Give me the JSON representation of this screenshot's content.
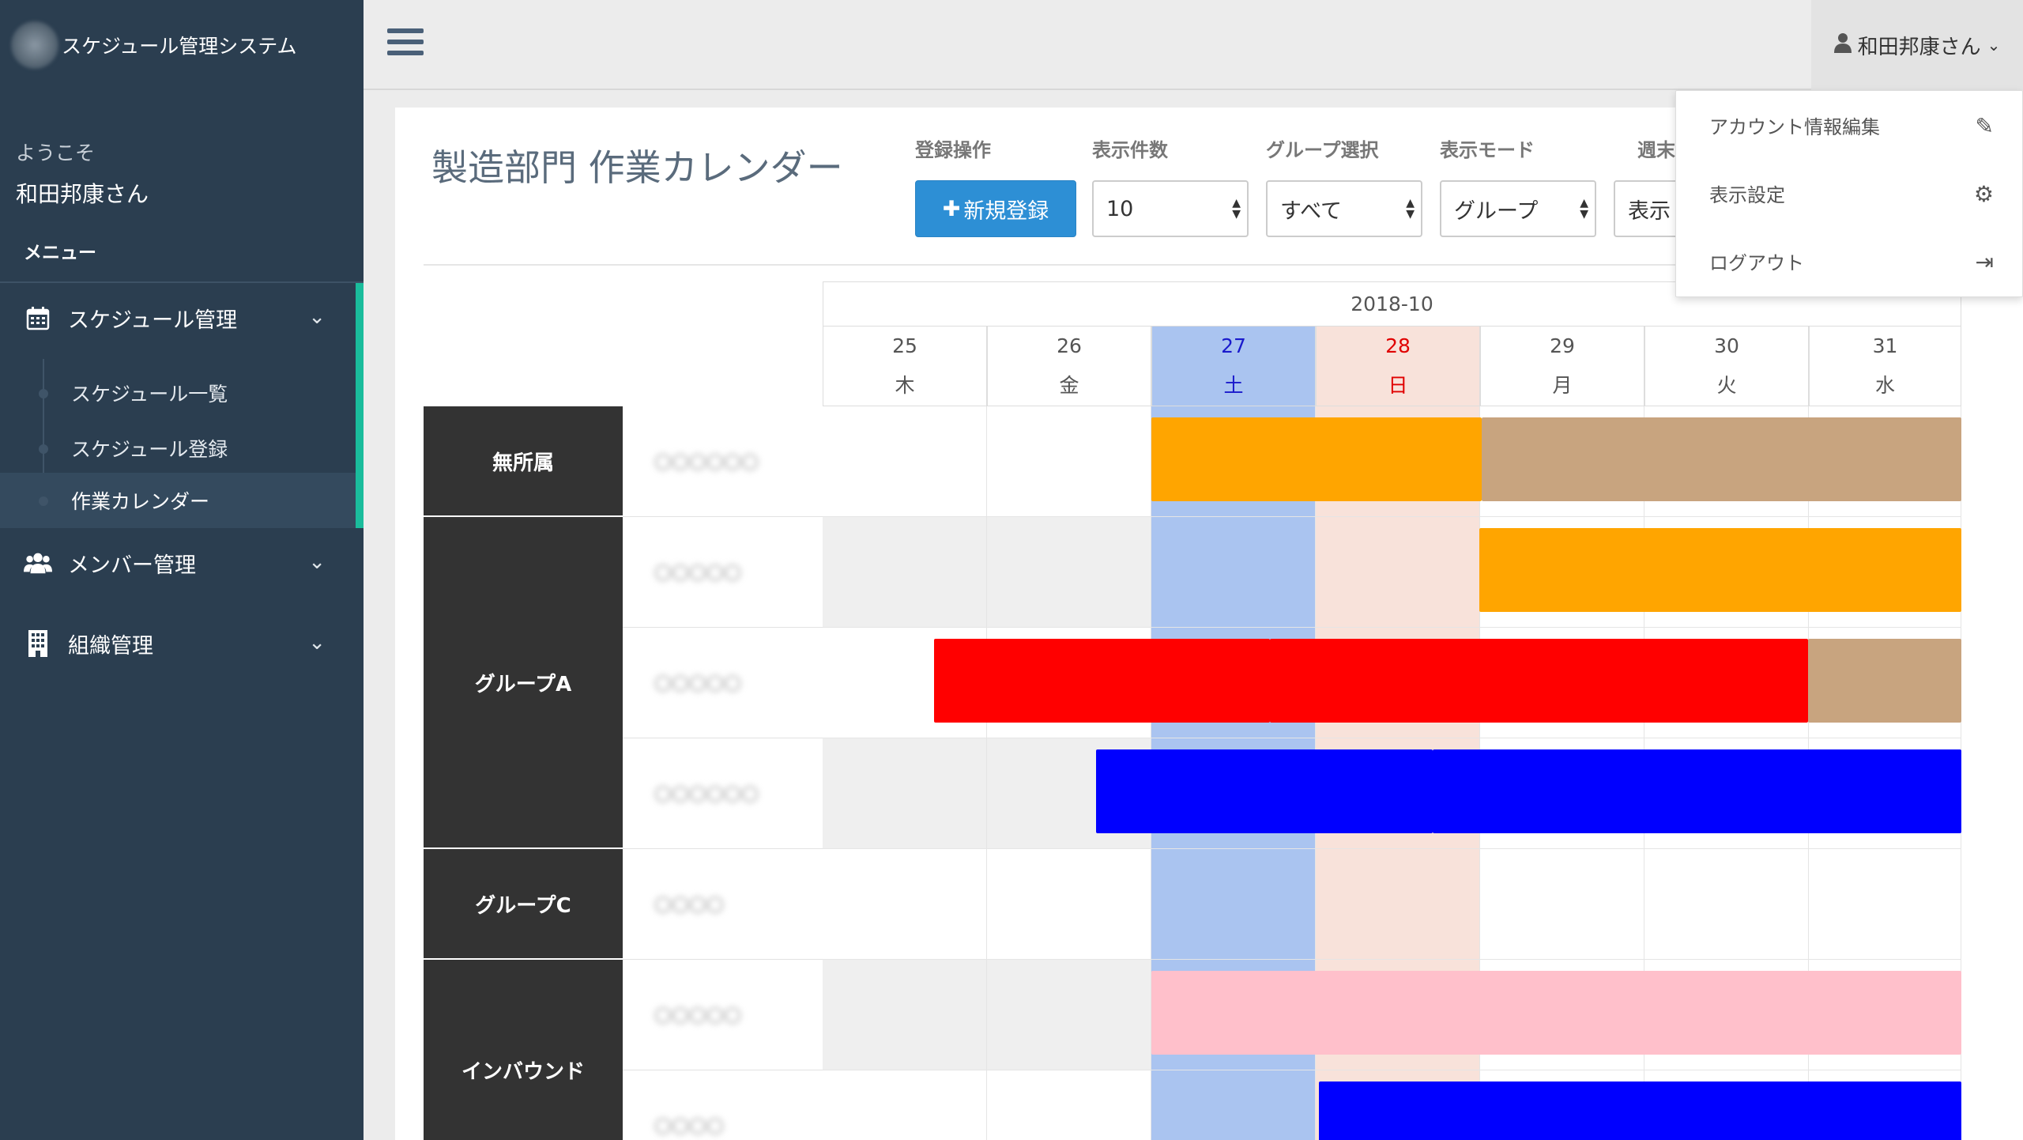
{
  "app": {
    "title": "スケジュール管理システム"
  },
  "sidebar": {
    "welcome_label": "ようこそ",
    "user_name": "和田邦康さん",
    "menu_heading": "メニュー",
    "items": [
      {
        "label": "スケジュール管理",
        "icon": "calendar-icon"
      },
      {
        "label": "メンバー管理",
        "icon": "users-icon"
      },
      {
        "label": "組織管理",
        "icon": "building-icon"
      }
    ],
    "sub_items": [
      {
        "label": "スケジュール一覧"
      },
      {
        "label": "スケジュール登録"
      },
      {
        "label": "作業カレンダー"
      }
    ]
  },
  "topbar": {
    "user_button_label": "和田邦康さん"
  },
  "user_menu": {
    "items": [
      {
        "label": "アカウント情報編集",
        "icon": "pencil-icon"
      },
      {
        "label": "表示設定",
        "icon": "gear-icon"
      },
      {
        "label": "ログアウト",
        "icon": "sign-out-icon"
      }
    ]
  },
  "page": {
    "title": "製造部門 作業カレンダー",
    "controls": {
      "register_label": "登録操作",
      "new_button": "新規登録",
      "count_label": "表示件数",
      "count_value": "10",
      "group_label": "グループ選択",
      "group_value": "すべて",
      "mode_label": "表示モード",
      "mode_value": "グループ",
      "week_label": "週末",
      "week_value": "表示"
    }
  },
  "calendar": {
    "month": "2018-10",
    "days": [
      {
        "date": "25",
        "weekday": "木"
      },
      {
        "date": "26",
        "weekday": "金"
      },
      {
        "date": "27",
        "weekday": "土"
      },
      {
        "date": "28",
        "weekday": "日"
      },
      {
        "date": "29",
        "weekday": "月"
      },
      {
        "date": "30",
        "weekday": "火"
      },
      {
        "date": "31",
        "weekday": "水"
      }
    ],
    "groups": [
      {
        "name": "無所属"
      },
      {
        "name": "グループA"
      },
      {
        "name": "グループC"
      },
      {
        "name": "インバウンド"
      }
    ],
    "members": [
      {
        "name": "〇〇〇〇〇〇"
      },
      {
        "name": "〇〇〇〇〇"
      },
      {
        "name": "〇〇〇〇〇"
      },
      {
        "name": "〇〇〇〇〇〇"
      },
      {
        "name": "〇〇〇〇"
      },
      {
        "name": "〇〇〇〇〇"
      },
      {
        "name": "〇〇〇〇"
      }
    ],
    "colors": {
      "orange": "#ffa500",
      "tan": "#c8a47f",
      "red": "#ff0000",
      "blue": "#0000ff",
      "pink": "#ffc0cb",
      "green": "#c4e0a6",
      "saturday": "#aac4f0",
      "sunday": "#f8e2da"
    }
  }
}
